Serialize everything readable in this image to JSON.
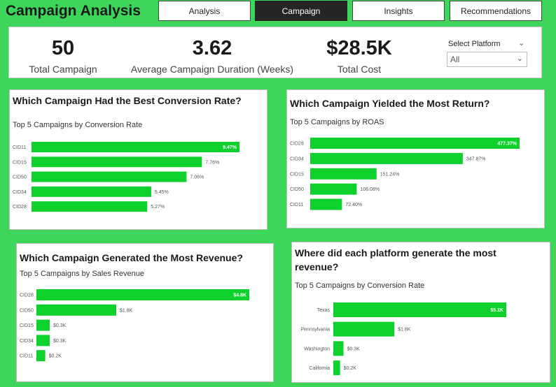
{
  "header": {
    "title": "Campaign Analysis"
  },
  "nav": [
    {
      "label": "Analysis",
      "active": false
    },
    {
      "label": "Campaign",
      "active": true
    },
    {
      "label": "Insights",
      "active": false
    },
    {
      "label": "Recommendations",
      "active": false
    }
  ],
  "kpis": [
    {
      "value": "50",
      "label": "Total Campaign"
    },
    {
      "value": "3.62",
      "label": "Average Campaign Duration (Weeks)"
    },
    {
      "value": "$28.5K",
      "label": "Total Cost"
    }
  ],
  "slicer": {
    "title": "Select Platform",
    "value": "All"
  },
  "colors": {
    "background": "#3dd65a",
    "bar": "#0fd12e",
    "active_tab": "#252525"
  },
  "cards": [
    {
      "title": "Which Campaign Had the Best Conversion Rate?",
      "subtitle": "Top 5 Campaigns by Conversion Rate"
    },
    {
      "title": "Which Campaign Yielded the Most Return?",
      "subtitle": "Top 5 Campaigns by ROAS"
    },
    {
      "title": "Which Campaign Generated the Most Revenue?",
      "subtitle": "Top 5 Campaigns by Sales Revenue"
    },
    {
      "title": "Where did each platform generate the most revenue?",
      "subtitle": "Top 5 Campaigns by Conversion Rate"
    }
  ],
  "chart_data": [
    {
      "type": "bar",
      "orientation": "horizontal",
      "title": "Top 5 Campaigns by Conversion Rate",
      "categories": [
        "CID11",
        "CID15",
        "CID50",
        "CID34",
        "CID28"
      ],
      "values": [
        9.47,
        7.76,
        7.06,
        5.45,
        5.27
      ],
      "labels": [
        "9.47%",
        "7.76%",
        "7.06%",
        "5.45%",
        "5.27%"
      ]
    },
    {
      "type": "bar",
      "orientation": "horizontal",
      "title": "Top 5 Campaigns by ROAS",
      "categories": [
        "CID28",
        "CID34",
        "CID15",
        "CID50",
        "CID11"
      ],
      "values": [
        477.37,
        347.87,
        151.24,
        106.08,
        72.4
      ],
      "labels": [
        "477.37%",
        "347.87%",
        "151.24%",
        "106.08%",
        "72.40%"
      ]
    },
    {
      "type": "bar",
      "orientation": "horizontal",
      "title": "Top 5 Campaigns by Sales Revenue",
      "categories": [
        "CID28",
        "CID50",
        "CID15",
        "CID34",
        "CID11"
      ],
      "values": [
        4.8,
        1.8,
        0.3,
        0.3,
        0.2
      ],
      "labels": [
        "$4.8K",
        "$1.8K",
        "$0.3K",
        "$0.3K",
        "$0.2K"
      ]
    },
    {
      "type": "bar",
      "orientation": "horizontal",
      "title": "Top 5 Campaigns by Conversion Rate",
      "categories": [
        "Texas",
        "Pennsylvania",
        "Washington",
        "California"
      ],
      "values": [
        5.1,
        1.8,
        0.3,
        0.2
      ],
      "labels": [
        "$5.1K",
        "$1.8K",
        "$0.3K",
        "$0.2K"
      ]
    }
  ]
}
